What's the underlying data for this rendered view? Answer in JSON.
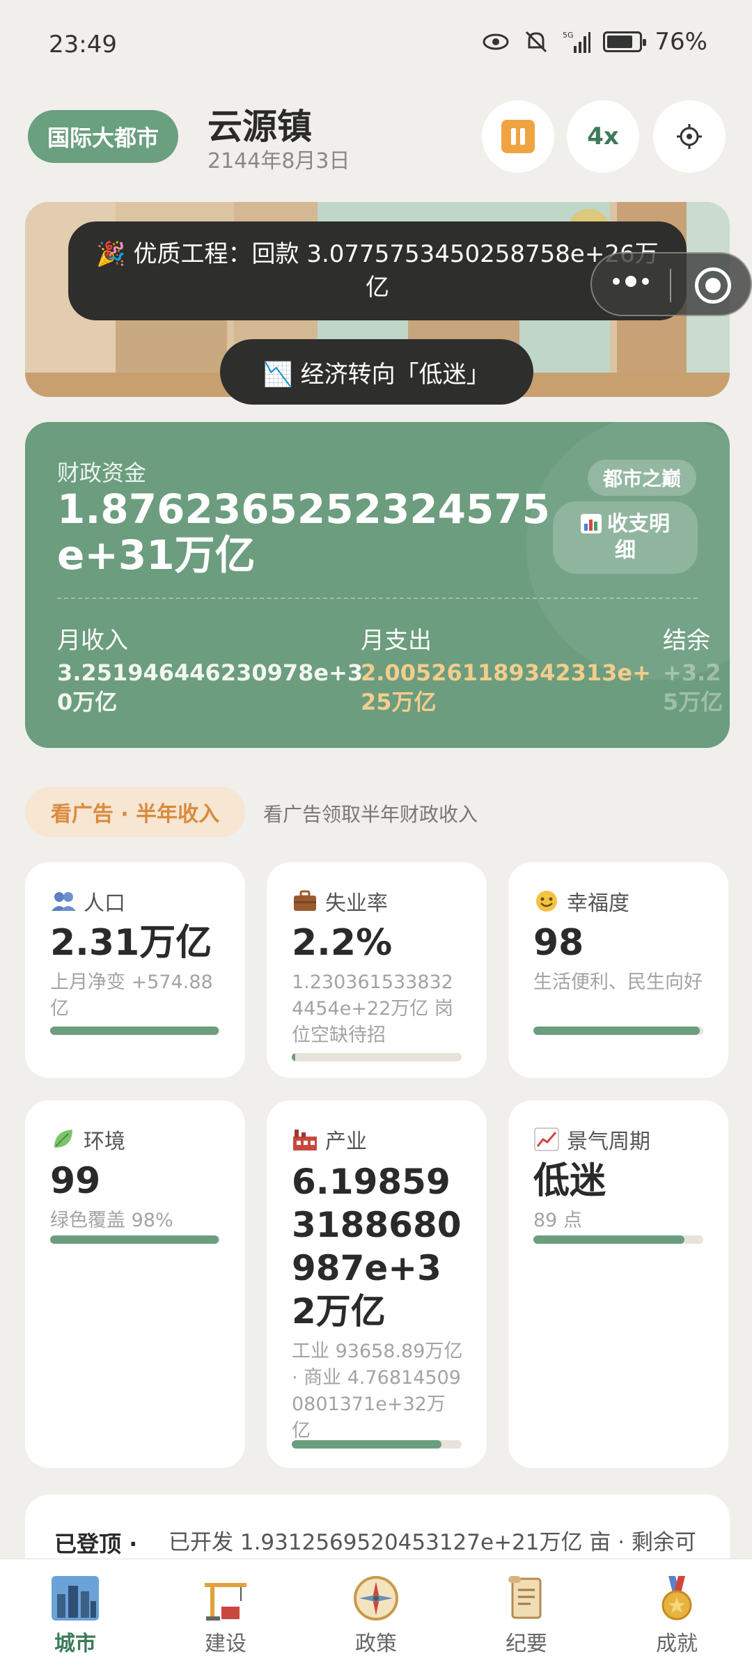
{
  "status_bar": {
    "time": "23:49",
    "network": "5G",
    "battery": "76%"
  },
  "header": {
    "tier": "国际大都市",
    "town_name": "云源镇",
    "date": "2144年8月3日",
    "speed": "4x"
  },
  "toasts": {
    "project": "🎉 优质工程：回款 3.0775753450258758e+26万亿",
    "economy": "📉 经济转向「低迷」"
  },
  "finance": {
    "label": "财政资金",
    "value": "1.8762365252324575e+31万亿",
    "badge": "都市之巅",
    "detail_button": "收支明细",
    "income_label": "月收入",
    "income_value": "3.251946446230978e+30万亿",
    "expense_label": "月支出",
    "expense_value": "2.005261189342313e+25万亿",
    "balance_label": "结余",
    "balance_value": "+3.25万亿"
  },
  "ad": {
    "button": "看广告 · 半年收入",
    "desc": "看广告领取半年财政收入"
  },
  "stats": {
    "population": {
      "title": "人口",
      "value": "2.31万亿",
      "sub": "上月净变 +574.88亿",
      "level": 0.99
    },
    "unemployment": {
      "title": "失业率",
      "value": "2.2%",
      "sub": "1.2303615338324454e+22万亿 岗位空缺待招",
      "level": 0.02
    },
    "happiness": {
      "title": "幸福度",
      "value": "98",
      "sub": "生活便利、民生向好",
      "level": 0.98
    },
    "environment": {
      "title": "环境",
      "value": "99",
      "sub": "绿色覆盖 98%",
      "level": 0.99
    },
    "industry": {
      "title": "产业",
      "value": "6.198593188680987e+32万亿",
      "sub": "工业 93658.89万亿 · 商业 4.768145090801371e+32万亿",
      "level": 0.88
    },
    "cycle": {
      "title": "景气周期",
      "value": "低迷",
      "sub": "89 点",
      "level": 0.89
    }
  },
  "info": {
    "title": "已登顶 ·",
    "text": "已开发 1.9312569520453127e+21万亿 亩 · 剩余可"
  },
  "tabs": [
    {
      "label": "城市",
      "icon": "city-icon",
      "active": true
    },
    {
      "label": "建设",
      "icon": "crane-icon",
      "active": false
    },
    {
      "label": "政策",
      "icon": "compass-icon",
      "active": false
    },
    {
      "label": "纪要",
      "icon": "scroll-icon",
      "active": false
    },
    {
      "label": "成就",
      "icon": "medal-icon",
      "active": false
    }
  ],
  "colors": {
    "accent_green": "#6b9d7e",
    "dark_green": "#3d7a5a",
    "orange": "#f0a341",
    "gold_text": "#f3cd8d",
    "background": "#f1efeb"
  }
}
